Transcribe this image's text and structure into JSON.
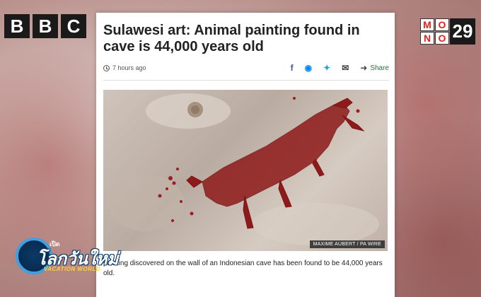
{
  "channel_logo": {
    "letters": [
      "B",
      "B",
      "C"
    ]
  },
  "station_logo": {
    "letters": [
      "M",
      "O",
      "N",
      "O"
    ],
    "number": "29"
  },
  "article": {
    "headline": "Sulawesi art: Animal painting found in cave is 44,000 years old",
    "timestamp": "7 hours ago",
    "share_label": "Share",
    "icons": [
      "clock-icon",
      "facebook-icon",
      "messenger-icon",
      "twitter-icon",
      "email-icon",
      "share-icon"
    ],
    "photo_credit": "MAXIME AUBERT / PA WIRE",
    "caption": "painting discovered on the wall of an Indonesian cave has been found to be 44,000 years old."
  },
  "program_logo": {
    "small": "เปิด",
    "main": "โลกวันใหม่",
    "sub": "VACATION WORLD"
  },
  "colors": {
    "paint_red": "#8e1a1a",
    "brand_dark": "#1a1a1a",
    "mono_red": "#e2231a"
  }
}
